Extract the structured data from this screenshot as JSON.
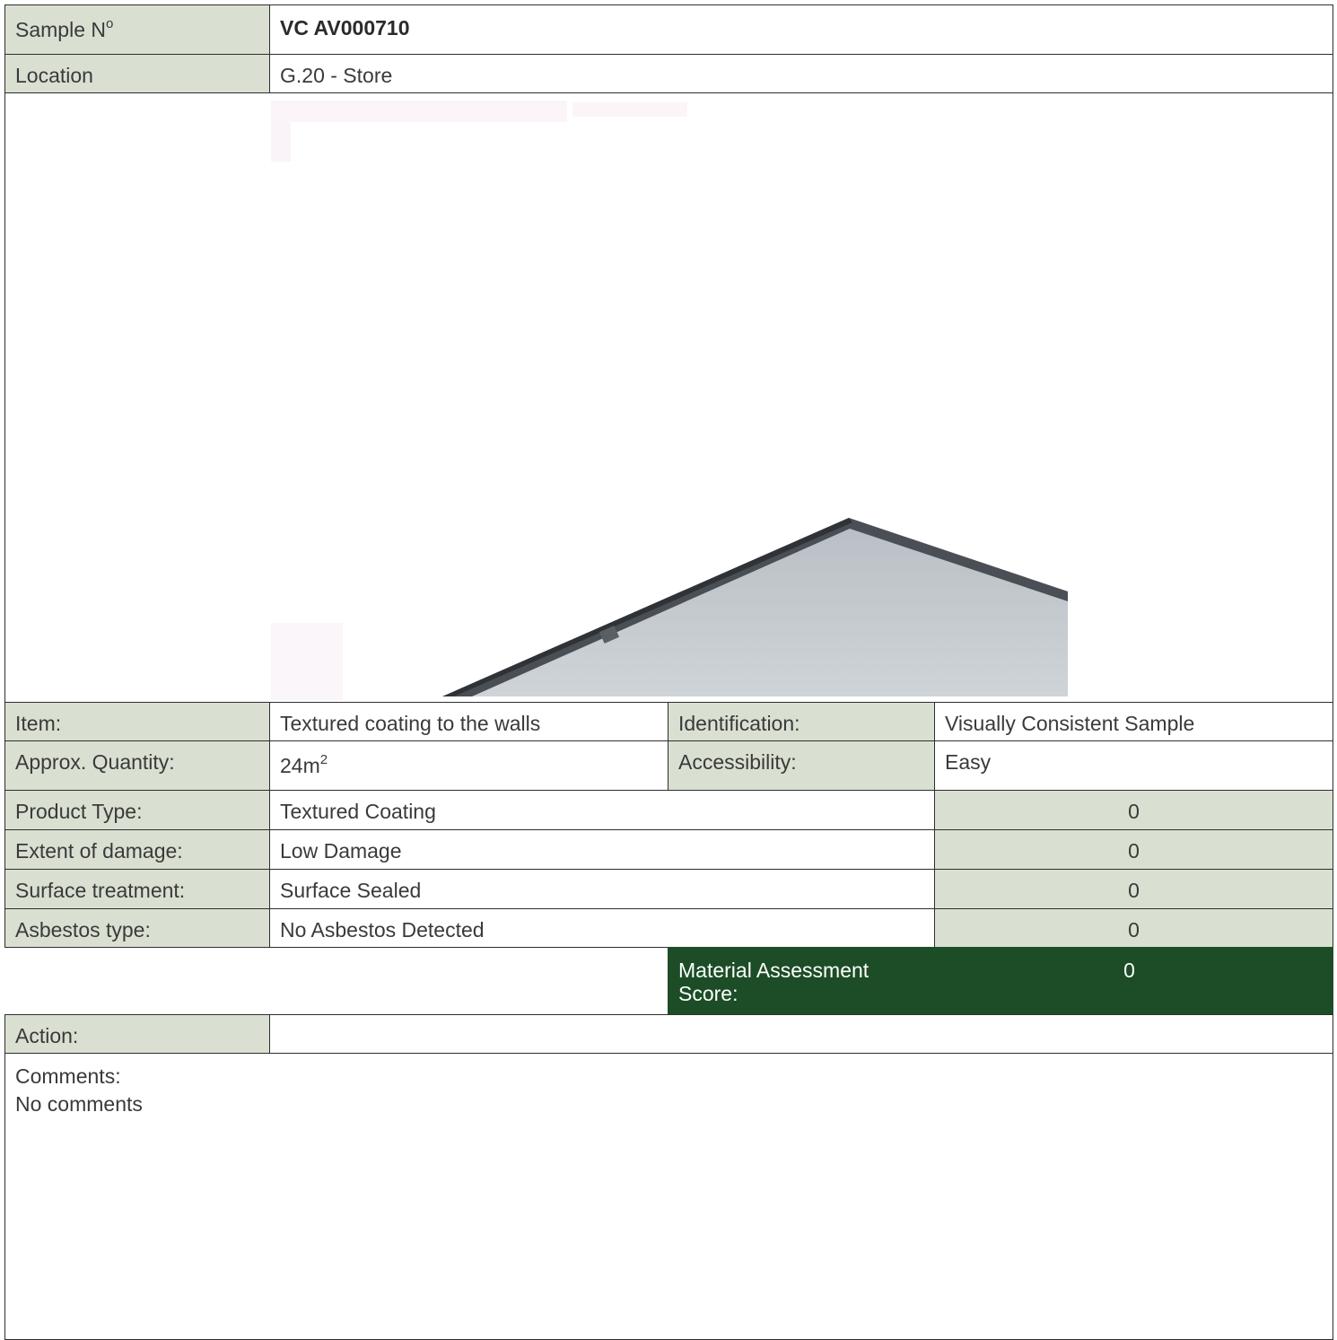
{
  "header": {
    "sample_label": "Sample N",
    "sample_sup": "o",
    "sample_value": "VC AV000710",
    "location_label": "Location",
    "location_value": "G.20 - Store"
  },
  "details": {
    "item_label": "Item:",
    "item_value": "Textured coating to the walls",
    "identification_label": "Identification:",
    "identification_value": "Visually Consistent Sample",
    "quantity_label": "Approx. Quantity:",
    "quantity_value": "24m",
    "quantity_sup": "2",
    "accessibility_label": "Accessibility:",
    "accessibility_value": "Easy"
  },
  "assessment": {
    "rows": [
      {
        "label": "Product Type:",
        "value": "Textured Coating",
        "score": "0"
      },
      {
        "label": "Extent of damage:",
        "value": "Low Damage",
        "score": "0"
      },
      {
        "label": "Surface treatment:",
        "value": "Surface Sealed",
        "score": "0"
      },
      {
        "label": "Asbestos type:",
        "value": "No Asbestos Detected",
        "score": "0"
      }
    ],
    "total_label": "Material Assessment Score:",
    "total_score": "0",
    "total_color": "#1c4d26"
  },
  "action": {
    "label": "Action:",
    "value": ""
  },
  "comments": {
    "label": "Comments:",
    "value": "No comments"
  },
  "colors": {
    "label_bg": "#d9e0d2",
    "border": "#2e2e2e"
  }
}
